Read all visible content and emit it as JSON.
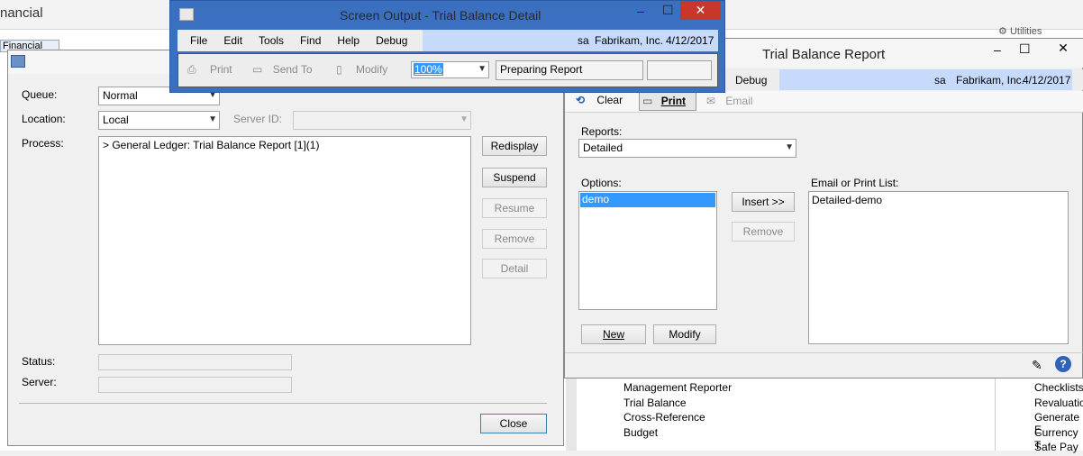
{
  "bg": {
    "top_label": "nancial",
    "tab_label": "Financial",
    "utilities_label": "Utilities",
    "nav_items": [
      "Management Reporter",
      "Trial Balance",
      "Cross-Reference",
      "Budget"
    ],
    "right_nav_items": [
      "Checklists",
      "Revaluation",
      "Generate E",
      "Currency T",
      "Safe Pay"
    ]
  },
  "queue_window": {
    "queue_label": "Queue:",
    "queue_value": "Normal",
    "location_label": "Location:",
    "location_value": "Local",
    "server_id_label": "Server ID:",
    "process_label": "Process:",
    "process_item": "> General Ledger: Trial Balance Report [1](1)",
    "status_label": "Status:",
    "server_label": "Server:",
    "buttons": {
      "redisplay": "Redisplay",
      "suspend": "Suspend",
      "resume": "Resume",
      "remove": "Remove",
      "detail": "Detail",
      "close": "Close"
    }
  },
  "screen_output": {
    "title": "Screen Output - Trial Balance Detail",
    "menu": [
      "File",
      "Edit",
      "Tools",
      "Find",
      "Help",
      "Debug"
    ],
    "user": "sa",
    "company": "Fabrikam, Inc.",
    "date": "4/12/2017",
    "toolbar": {
      "print": "Print",
      "send_to": "Send To",
      "modify": "Modify"
    },
    "zoom": "100%",
    "status": "Preparing Report"
  },
  "trial_balance": {
    "title": "Trial Balance Report",
    "menu_debug": "Debug",
    "user": "sa",
    "company": "Fabrikam, Inc.",
    "date": "4/12/2017",
    "toolbar": {
      "clear": "Clear",
      "print": "Print",
      "email": "Email"
    },
    "reports_label": "Reports:",
    "reports_value": "Detailed",
    "options_label": "Options:",
    "options": [
      "demo"
    ],
    "email_list_label": "Email or Print List:",
    "email_list": [
      "Detailed-demo"
    ],
    "buttons": {
      "insert": "Insert >>",
      "remove": "Remove",
      "new": "New",
      "modify": "Modify"
    }
  },
  "colors": {
    "title_blue": "#3b6fc0",
    "close_red": "#c9372c",
    "list_select": "#3399ff",
    "header_strip": "#c6dafc"
  }
}
